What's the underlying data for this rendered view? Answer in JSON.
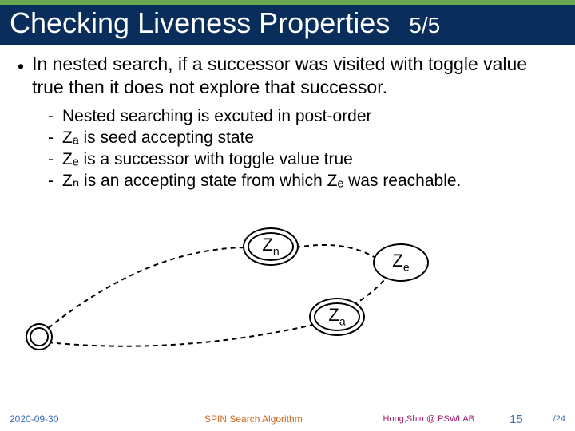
{
  "header": {
    "title": "Checking Liveness Properties",
    "progress": "5/5"
  },
  "bullet": {
    "marker": "•",
    "text": "In nested search, if a successor was visited with toggle value true then it does not explore that successor."
  },
  "sub": {
    "marker": "-",
    "items": [
      "Nested searching is excuted in post-order",
      "Zₐ is seed accepting state",
      "Zₑ is a successor with toggle value true",
      "Zₙ is an accepting state from which Zₑ was reachable."
    ]
  },
  "nodes": {
    "zn": "Zn",
    "ze": "Ze",
    "za": "Za"
  },
  "footer": {
    "date": "2020-09-30",
    "algo": "SPIN Search Algorithm",
    "lab": "Hong,Shin @ PSWLAB",
    "page_num": "15",
    "page_total": "/24"
  }
}
